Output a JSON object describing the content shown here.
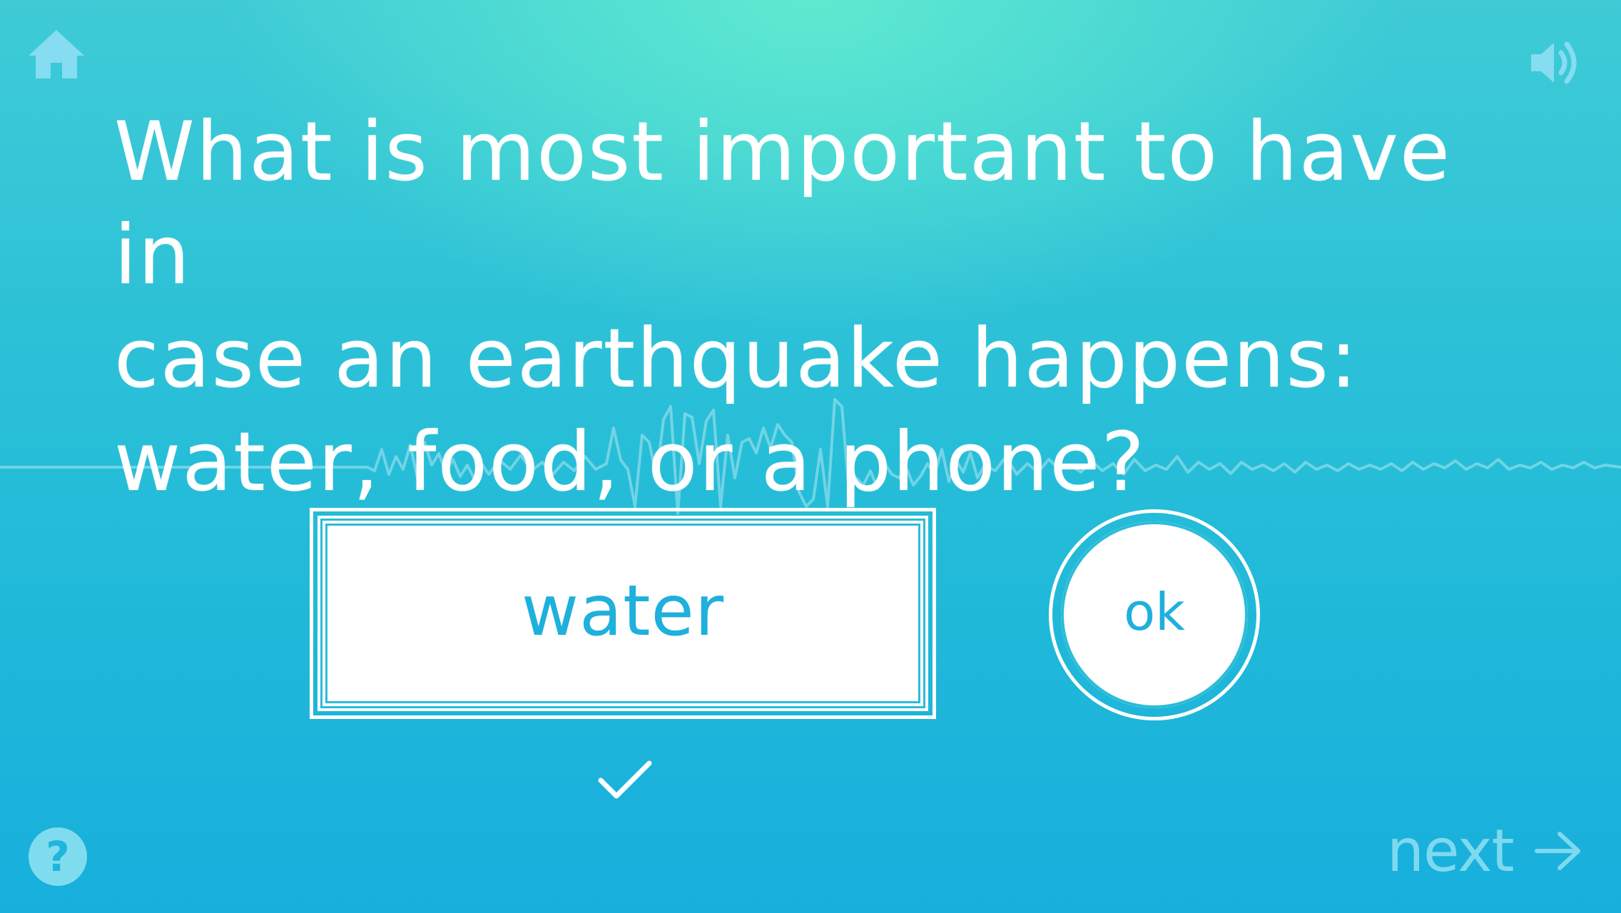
{
  "question": {
    "line1": "What is most important to have in",
    "line2": "case an earthquake happens:",
    "line3": "water, food, or a phone?"
  },
  "answer": {
    "value": "water"
  },
  "ok_button": {
    "label": "ok"
  },
  "next_button": {
    "label": "next"
  },
  "help_button": {
    "glyph": "?"
  },
  "icons": {
    "home": "home-icon",
    "sound": "speaker-icon",
    "help": "question-mark-icon",
    "check": "checkmark-icon",
    "next": "arrow-right-icon"
  },
  "colors": {
    "background_top": "#5eead0",
    "background_bottom": "#17afdc",
    "accent_text": "#1fb0dc",
    "faded_icon": "#7fd9ee"
  }
}
